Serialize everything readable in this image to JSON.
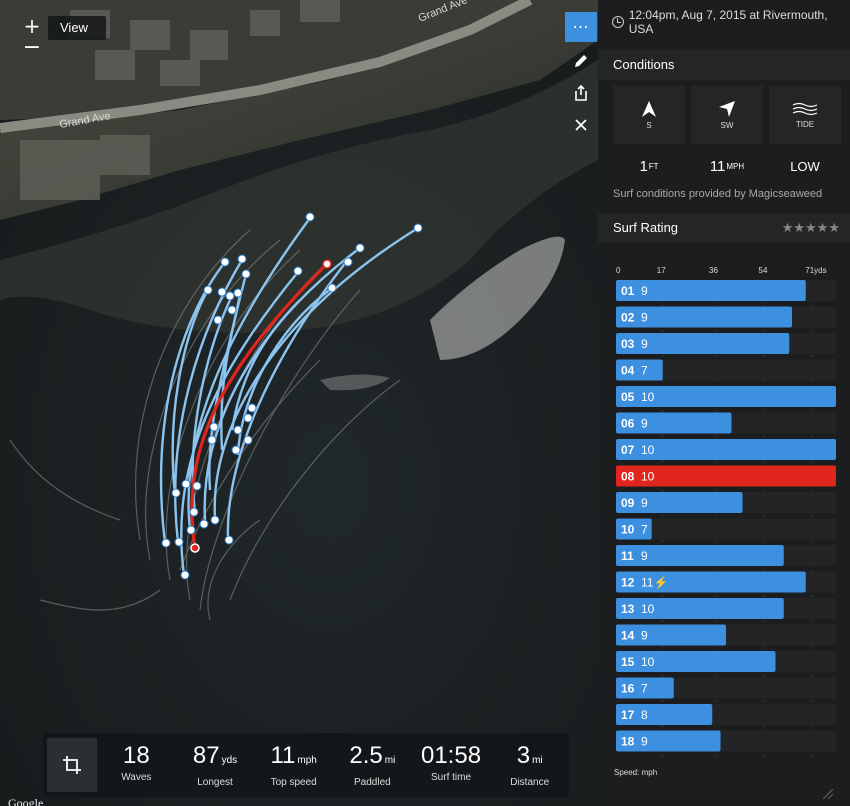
{
  "map": {
    "zoom_in": "+",
    "zoom_out": "−",
    "view_label": "View",
    "street_label_1": "Grand Ave",
    "street_label_2": "Grand Ave",
    "attribution": "Google",
    "tools": {
      "more": "⋯",
      "edit": "edit-icon",
      "share": "share-icon",
      "close": "close-icon"
    }
  },
  "stats": [
    {
      "value": "18",
      "unit": "",
      "label": "Waves"
    },
    {
      "value": "87",
      "unit": "yds",
      "label": "Longest"
    },
    {
      "value": "11",
      "unit": "mph",
      "label": "Top speed"
    },
    {
      "value": "2.5",
      "unit": "mi",
      "label": "Paddled"
    },
    {
      "value": "01:58",
      "unit": "",
      "label": "Surf time"
    },
    {
      "value": "3",
      "unit": "mi",
      "label": "Distance"
    }
  ],
  "session": {
    "datetime_location": "12:04pm, Aug 7, 2015 at Rivermouth, USA"
  },
  "conditions": {
    "title": "Conditions",
    "swell_dir": "S",
    "wind_dir": "SW",
    "tide_label": "TIDE",
    "swell_height": "1",
    "swell_unit": "FT",
    "wind_speed": "11",
    "wind_unit": "MPH",
    "tide_value": "LOW",
    "provider": "Surf conditions provided by Magicseaweed"
  },
  "rating": {
    "title": "Surf Rating",
    "stars": "★★★★★"
  },
  "speed_label": "Speed: mph",
  "colors": {
    "accent": "#3d8fe0",
    "highlight": "#e0261c",
    "track": "#8cc4f0"
  },
  "chart_data": {
    "type": "bar",
    "orientation": "horizontal",
    "axis_ticks": [
      "0",
      "17",
      "36",
      "54",
      "71yds"
    ],
    "xlim": [
      0,
      71
    ],
    "unit": "yds",
    "waves": [
      {
        "id": "01",
        "speed": "9",
        "distance": 69,
        "highlight": false
      },
      {
        "id": "02",
        "speed": "9",
        "distance": 64,
        "highlight": false
      },
      {
        "id": "03",
        "speed": "9",
        "distance": 63,
        "highlight": false
      },
      {
        "id": "04",
        "speed": "7",
        "distance": 17,
        "highlight": false
      },
      {
        "id": "05",
        "speed": "10",
        "distance": 80,
        "highlight": false
      },
      {
        "id": "06",
        "speed": "9",
        "distance": 42,
        "highlight": false
      },
      {
        "id": "07",
        "speed": "10",
        "distance": 80,
        "highlight": false
      },
      {
        "id": "08",
        "speed": "10",
        "distance": 80,
        "highlight": true
      },
      {
        "id": "09",
        "speed": "9",
        "distance": 46,
        "highlight": false
      },
      {
        "id": "10",
        "speed": "7",
        "distance": 13,
        "highlight": false
      },
      {
        "id": "11",
        "speed": "9",
        "distance": 61,
        "highlight": false
      },
      {
        "id": "12",
        "speed": "11⚡",
        "distance": 69,
        "highlight": false
      },
      {
        "id": "13",
        "speed": "10",
        "distance": 61,
        "highlight": false
      },
      {
        "id": "14",
        "speed": "9",
        "distance": 40,
        "highlight": false
      },
      {
        "id": "15",
        "speed": "10",
        "distance": 58,
        "highlight": false
      },
      {
        "id": "16",
        "speed": "7",
        "distance": 21,
        "highlight": false
      },
      {
        "id": "17",
        "speed": "8",
        "distance": 35,
        "highlight": false
      },
      {
        "id": "18",
        "speed": "9",
        "distance": 38,
        "highlight": false
      }
    ]
  }
}
